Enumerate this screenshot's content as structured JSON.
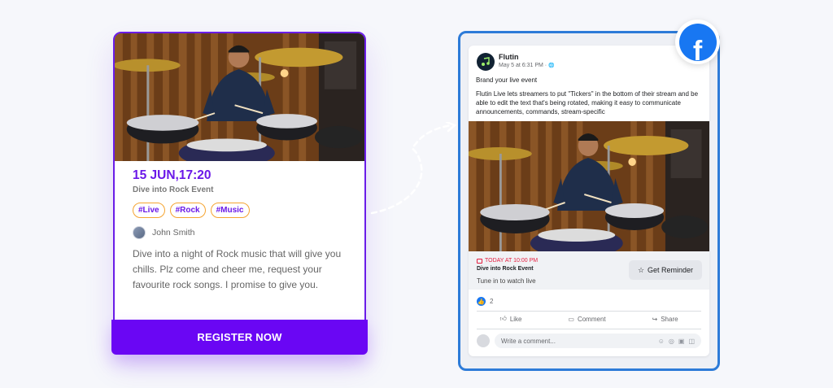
{
  "event_card": {
    "date": "15 JUN,17:20",
    "subtitle": "Dive into Rock Event",
    "tags": [
      "#Live",
      "#Rock",
      "#Music"
    ],
    "author": "John Smith",
    "description": "Dive into a night of Rock music that will give you chills. Plz come and cheer me, request your favourite rock songs. I promise to give you.",
    "register_label": "REGISTER NOW",
    "accent_color": "#6a06f4",
    "tag_border_color": "#f5a431"
  },
  "facebook_post": {
    "badge_letter": "f",
    "page_name": "Flutin",
    "timestamp": "May 5 at 6:31 PM · ",
    "globe_icon": "🌐",
    "headline": "Brand your live event",
    "body": "Flutin Live lets streamers to put \"Tickers\" in the bottom of their stream and be able to edit the text that's being rotated, making it easy to communicate announcements, commands, stream-specific",
    "live_time": "TODAY AT 10:00 PM",
    "live_title": "Dive into Rock Event",
    "live_subtitle": "Tune in to watch live",
    "reminder_label": "Get Reminder",
    "like_count": "2",
    "actions": [
      "Like",
      "Comment",
      "Share"
    ],
    "comment_placeholder": "Write a comment...",
    "comment_tool_icons": [
      "☺",
      "◎",
      "▣",
      "◫"
    ],
    "brand_color": "#1877f2",
    "frame_color": "#2d7bd8",
    "live_color": "#e41e3f"
  }
}
